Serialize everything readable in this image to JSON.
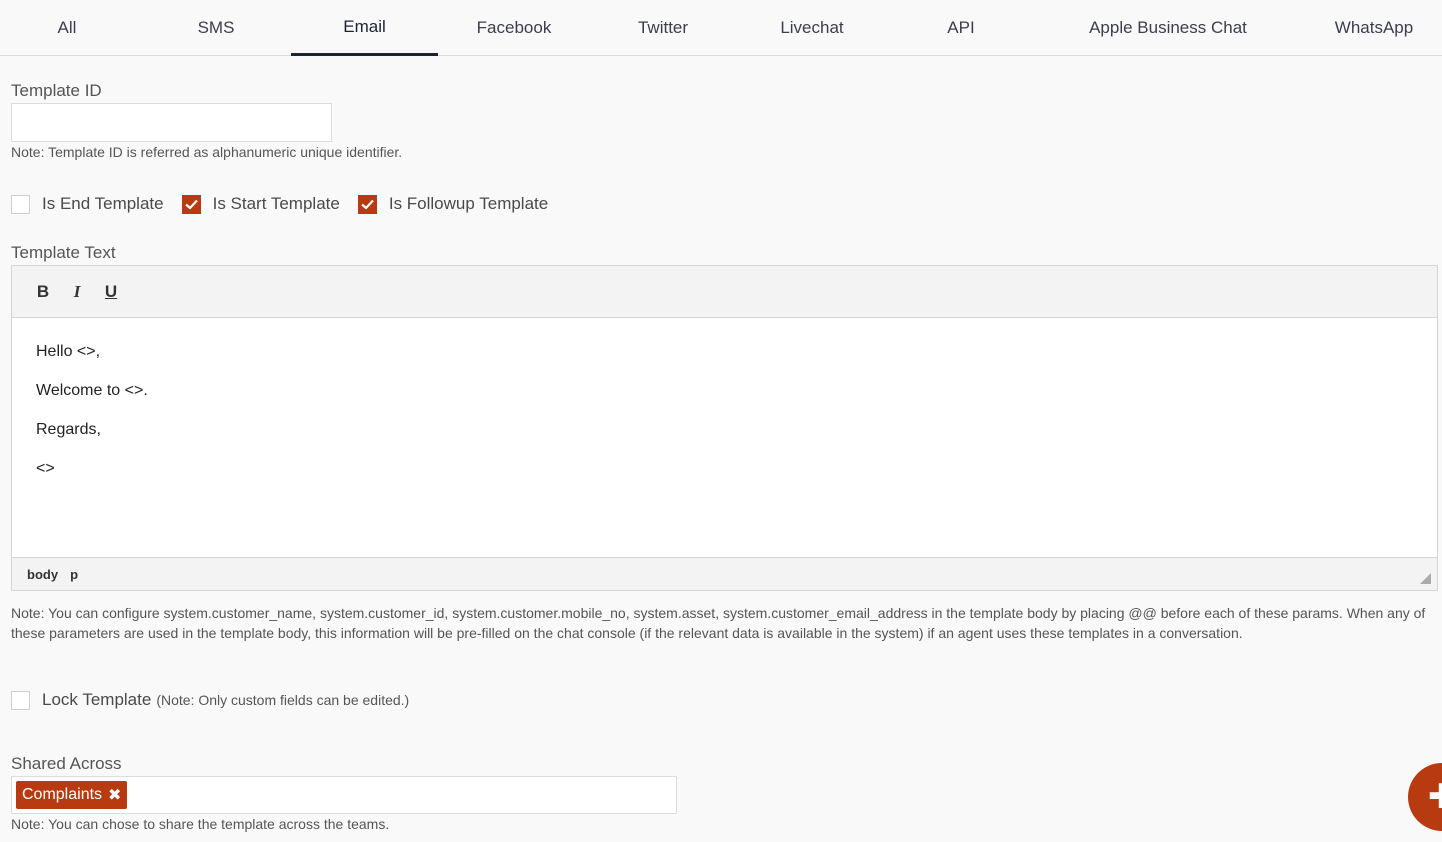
{
  "tabs": [
    {
      "label": "All"
    },
    {
      "label": "SMS"
    },
    {
      "label": "Email",
      "active": true
    },
    {
      "label": "Facebook"
    },
    {
      "label": "Twitter"
    },
    {
      "label": "Livechat"
    },
    {
      "label": "API"
    },
    {
      "label": "Apple Business Chat"
    },
    {
      "label": "WhatsApp"
    }
  ],
  "template_id": {
    "label": "Template ID",
    "value": "",
    "note": "Note: Template ID is referred as alphanumeric unique identifier."
  },
  "flags": {
    "end": {
      "label": "Is End Template",
      "checked": false
    },
    "start": {
      "label": "Is Start Template",
      "checked": true
    },
    "followup": {
      "label": "Is Followup Template",
      "checked": true
    }
  },
  "template_text": {
    "label": "Template Text",
    "toolbar": {
      "bold": "B",
      "italic": "I",
      "underline": "U"
    },
    "lines": [
      "Hello <>,",
      "Welcome to <>.",
      "Regards,",
      "<>"
    ],
    "path": [
      "body",
      "p"
    ]
  },
  "params_note": "Note: You can configure system.customer_name, system.customer_id, system.customer.mobile_no, system.asset, system.customer_email_address in the template body by placing @@ before each of these params. When any of these parameters are used in the template body, this information will be pre-filled on the chat console (if the relevant data is available in the system) if an agent uses these templates in a conversation.",
  "lock": {
    "label": "Lock Template",
    "note": "(Note: Only custom fields can be edited.)",
    "checked": false
  },
  "shared": {
    "label": "Shared Across",
    "tags": [
      "Complaints"
    ],
    "note": "Note: You can chose to share the template across the teams."
  },
  "colors": {
    "accent": "#b73a10",
    "active_tab": "#1e2235"
  },
  "icons": {
    "check": "check-icon",
    "remove": "close-icon",
    "add": "plus-icon",
    "resize": "resize-handle-icon"
  }
}
